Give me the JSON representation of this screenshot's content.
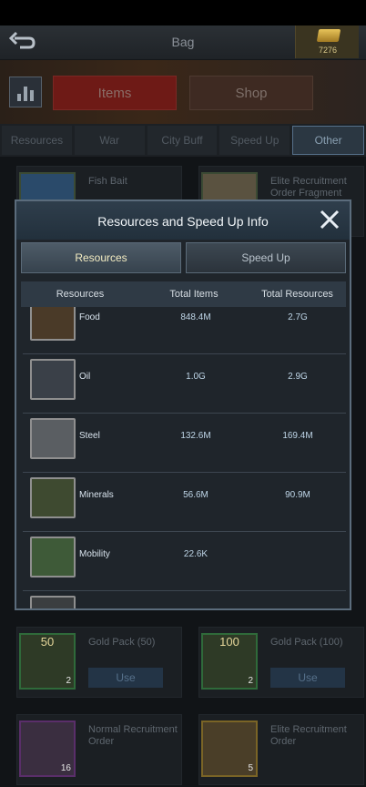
{
  "header": {
    "title": "Bag",
    "gold_amount": "7276"
  },
  "top_tabs": [
    {
      "label": "Items"
    },
    {
      "label": "Shop"
    }
  ],
  "categories": [
    {
      "label": "Resources"
    },
    {
      "label": "War"
    },
    {
      "label": "City Buff"
    },
    {
      "label": "Speed Up"
    },
    {
      "label": "Other"
    }
  ],
  "bag_items": [
    {
      "name": "Fish Bait"
    },
    {
      "name": "Elite Recruitment Order Fragment"
    },
    {
      "name": "Gold Pack (50)",
      "top": "50",
      "qty": "2",
      "use_label": "Use"
    },
    {
      "name": "Gold Pack (100)",
      "top": "100",
      "qty": "2",
      "use_label": "Use"
    },
    {
      "name": "Normal Recruitment Order",
      "qty": "16"
    },
    {
      "name": "Elite Recruitment Order",
      "qty": "5"
    }
  ],
  "modal": {
    "title": "Resources and Speed Up Info",
    "tabs": [
      {
        "label": "Resources"
      },
      {
        "label": "Speed Up"
      }
    ],
    "columns": [
      "Resources",
      "Total Items",
      "Total Resources"
    ],
    "rows": [
      {
        "name": "Food",
        "total_items": "848.4M",
        "total_resources": "2.7G",
        "icon": "food-icon"
      },
      {
        "name": "Oil",
        "total_items": "1.0G",
        "total_resources": "2.9G",
        "icon": "oil-icon"
      },
      {
        "name": "Steel",
        "total_items": "132.6M",
        "total_resources": "169.4M",
        "icon": "steel-icon"
      },
      {
        "name": "Minerals",
        "total_items": "56.6M",
        "total_resources": "90.9M",
        "icon": "minerals-icon"
      },
      {
        "name": "Mobility",
        "total_items": "22.6K",
        "total_resources": "",
        "icon": "mobility-icon"
      }
    ]
  }
}
